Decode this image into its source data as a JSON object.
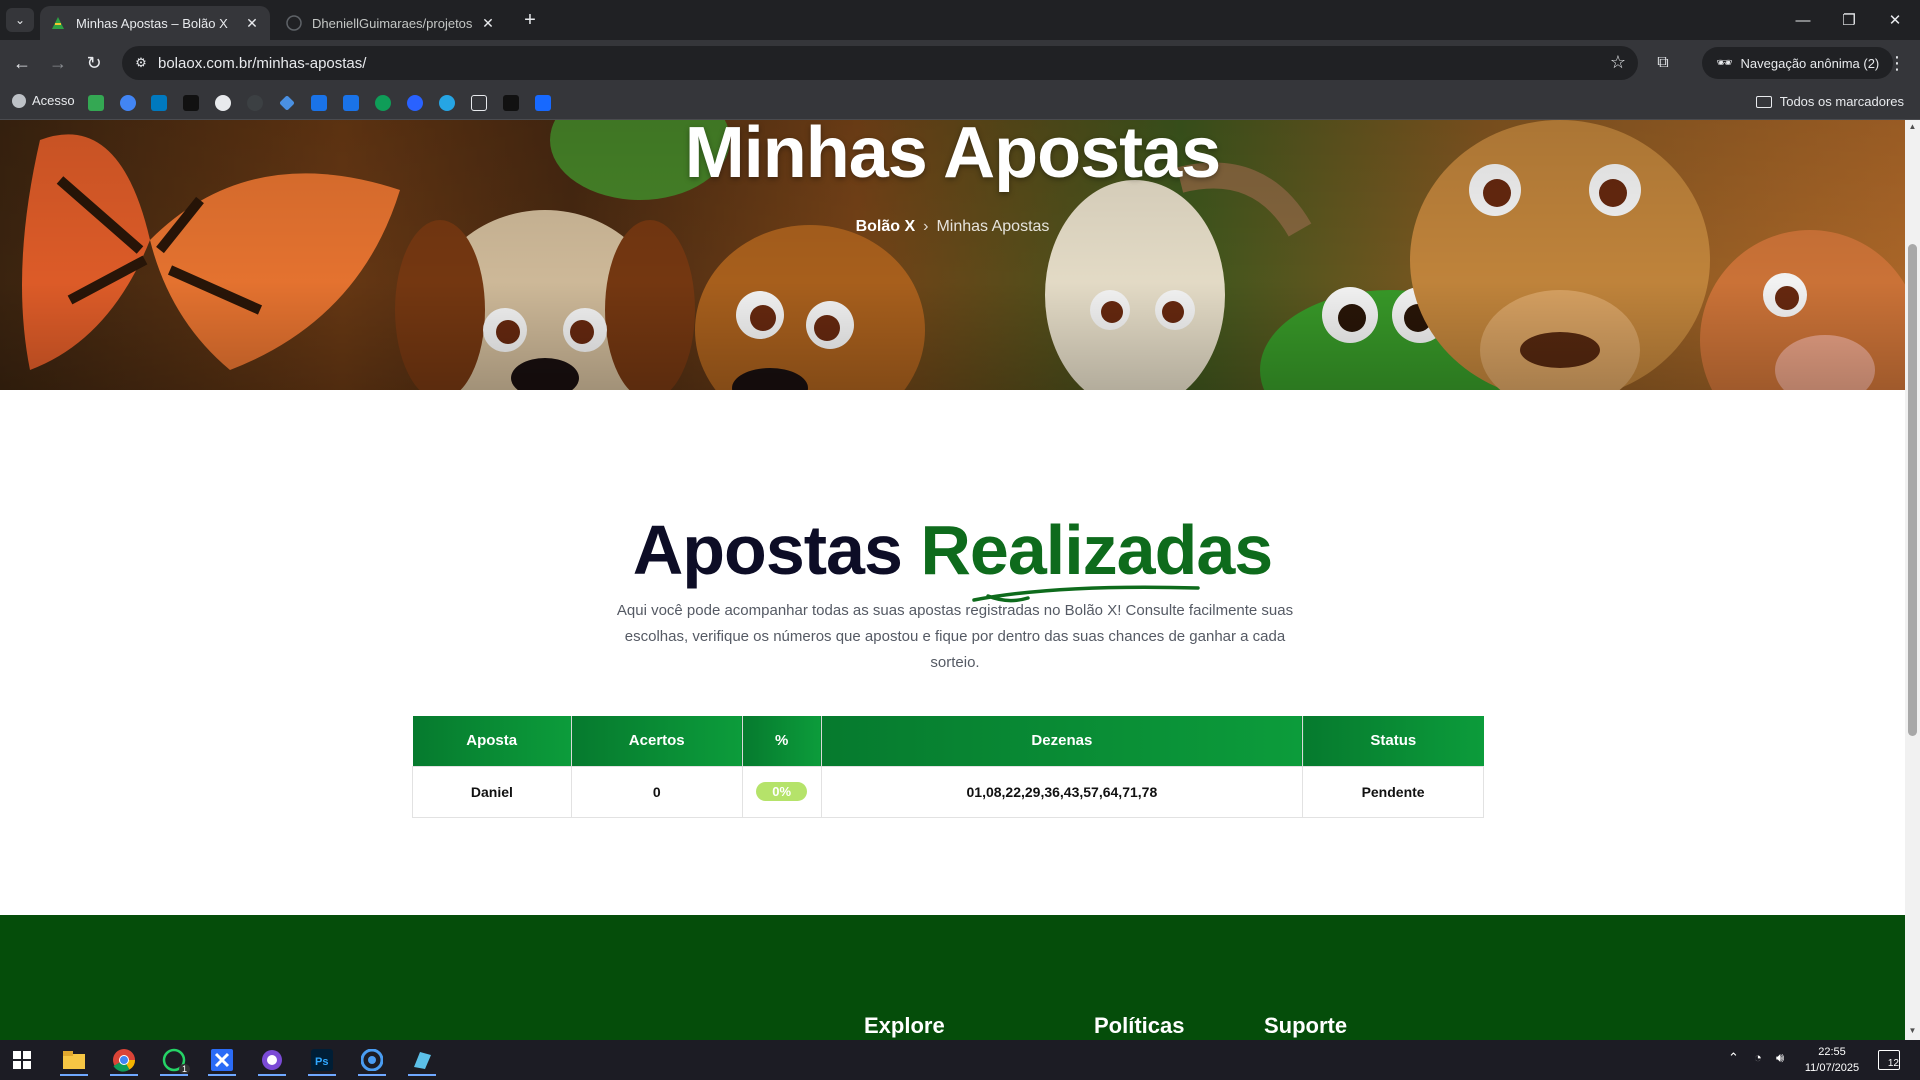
{
  "browser": {
    "tabs": [
      {
        "title": "Minhas Apostas – Bolão X",
        "active": true
      },
      {
        "title": "DheniellGuimaraes/projetos",
        "active": false
      }
    ],
    "url": "bolaox.com.br/minhas-apostas/",
    "incognito_label": "Navegação anônima (2)",
    "bookmarks": {
      "first_label": "Acesso",
      "all_label": "Todos os marcadores"
    }
  },
  "hero": {
    "title": "Minhas Apostas",
    "breadcrumb_home": "Bolão X",
    "breadcrumb_current": "Minhas Apostas"
  },
  "section": {
    "title_main": "Apostas ",
    "title_accent": "Realizadas",
    "description": "Aqui você pode acompanhar todas as suas apostas registradas no Bolão X! Consulte facilmente suas escolhas, verifique os números que apostou e fique por dentro das suas chances de ganhar a cada sorteio."
  },
  "table": {
    "headers": [
      "Aposta",
      "Acertos",
      "%",
      "Dezenas",
      "Status"
    ],
    "rows": [
      {
        "aposta": "Daniel",
        "acertos": "0",
        "percent": "0%",
        "dezenas": "01,08,22,29,36,43,57,64,71,78",
        "status": "Pendente"
      }
    ]
  },
  "footer": {
    "columns": [
      "Explore",
      "Políticas",
      "Suporte"
    ]
  },
  "taskbar": {
    "time": "22:55",
    "date": "11/07/2025",
    "notifications": "12",
    "whatsapp_badge": "1"
  },
  "colors": {
    "accent_green": "#0e6b1c",
    "header_green": "#0c9c3b",
    "footer_green": "#054d0a",
    "badge_lime": "#b5e36a"
  }
}
